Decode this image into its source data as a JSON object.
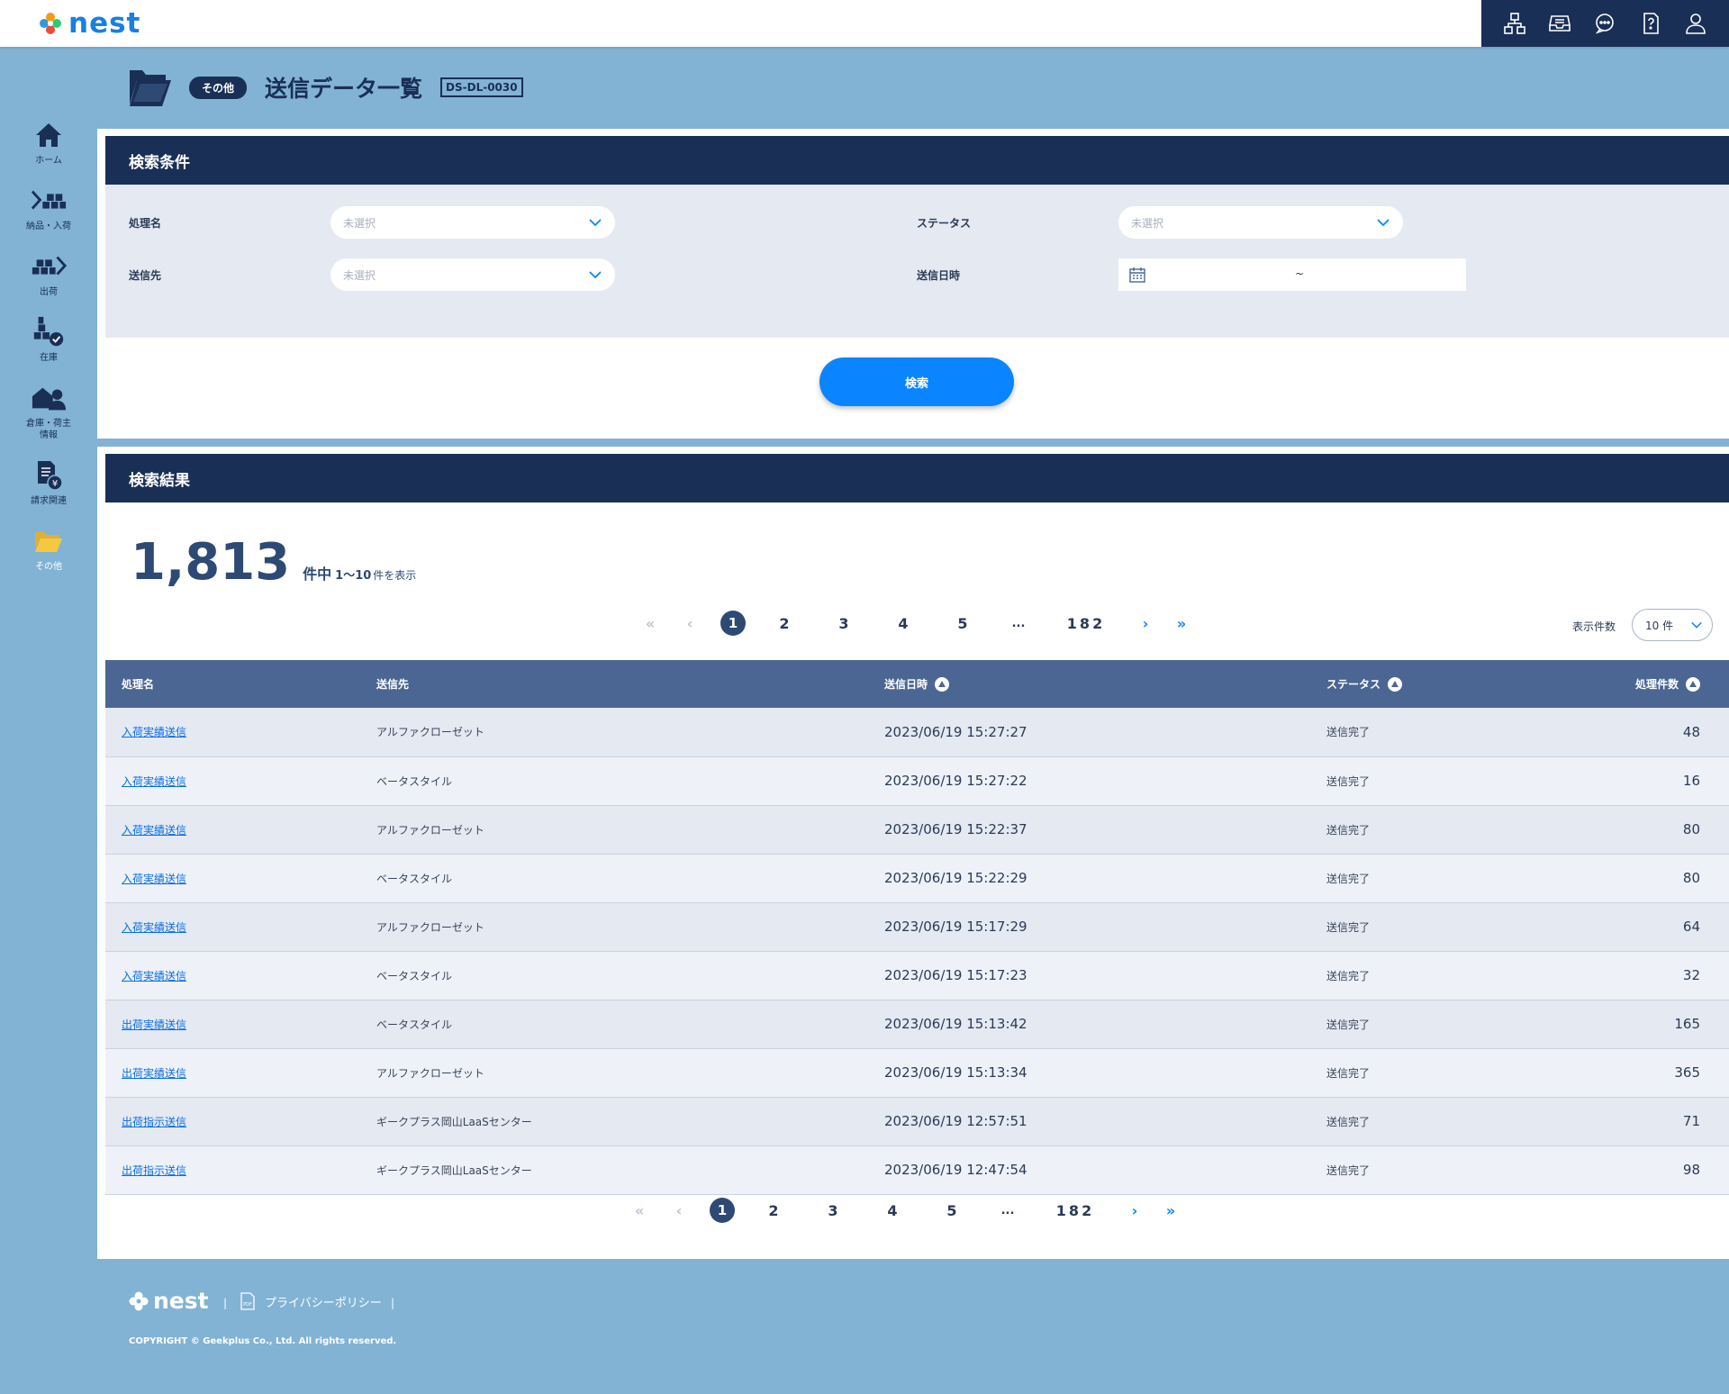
{
  "brand": {
    "name": "nest"
  },
  "topbar": {
    "icons": [
      "sitemap-icon",
      "inbox-icon",
      "chat-icon",
      "help-icon",
      "user-icon"
    ]
  },
  "sidebar": {
    "items": [
      {
        "label": "ホーム",
        "icon": "home-icon"
      },
      {
        "label": "納品・入荷",
        "icon": "inbound-icon"
      },
      {
        "label": "出荷",
        "icon": "outbound-icon"
      },
      {
        "label": "在庫",
        "icon": "stock-icon"
      },
      {
        "label": "倉庫・荷主\n情報",
        "icon": "warehouse-icon"
      },
      {
        "label": "請求関連",
        "icon": "billing-icon"
      },
      {
        "label": "その他",
        "icon": "folder-icon"
      }
    ]
  },
  "page": {
    "badge": "その他",
    "title": "送信データ一覧",
    "code": "DS-DL-0030"
  },
  "search": {
    "heading": "検索条件",
    "process_label": "処理名",
    "process_placeholder": "未選択",
    "dest_label": "送信先",
    "dest_placeholder": "未選択",
    "status_label": "ステータス",
    "status_placeholder": "未選択",
    "datetime_label": "送信日時",
    "range_sep": "~",
    "button": "検索"
  },
  "results": {
    "heading": "検索結果",
    "total": "1,813",
    "total_unit": "件中",
    "range": "1～10",
    "range_suffix": "件を表示",
    "per_page_label": "表示件数",
    "per_page_value": "10 件",
    "pages": [
      "1",
      "2",
      "3",
      "4",
      "5",
      "...",
      "182"
    ],
    "columns": {
      "process": "処理名",
      "dest": "送信先",
      "datetime": "送信日時",
      "status": "ステータス",
      "count": "処理件数"
    },
    "rows": [
      {
        "process": "入荷実績送信",
        "dest": "アルファクローゼット",
        "datetime": "2023/06/19 15:27:27",
        "status": "送信完了",
        "count": "48"
      },
      {
        "process": "入荷実績送信",
        "dest": "ベータスタイル",
        "datetime": "2023/06/19 15:27:22",
        "status": "送信完了",
        "count": "16"
      },
      {
        "process": "入荷実績送信",
        "dest": "アルファクローゼット",
        "datetime": "2023/06/19 15:22:37",
        "status": "送信完了",
        "count": "80"
      },
      {
        "process": "入荷実績送信",
        "dest": "ベータスタイル",
        "datetime": "2023/06/19 15:22:29",
        "status": "送信完了",
        "count": "80"
      },
      {
        "process": "入荷実績送信",
        "dest": "アルファクローゼット",
        "datetime": "2023/06/19 15:17:29",
        "status": "送信完了",
        "count": "64"
      },
      {
        "process": "入荷実績送信",
        "dest": "ベータスタイル",
        "datetime": "2023/06/19 15:17:23",
        "status": "送信完了",
        "count": "32"
      },
      {
        "process": "出荷実績送信",
        "dest": "ベータスタイル",
        "datetime": "2023/06/19 15:13:42",
        "status": "送信完了",
        "count": "165"
      },
      {
        "process": "出荷実績送信",
        "dest": "アルファクローゼット",
        "datetime": "2023/06/19 15:13:34",
        "status": "送信完了",
        "count": "365"
      },
      {
        "process": "出荷指示送信",
        "dest": "ギークプラス岡山LaaSセンター",
        "datetime": "2023/06/19 12:57:51",
        "status": "送信完了",
        "count": "71"
      },
      {
        "process": "出荷指示送信",
        "dest": "ギークプラス岡山LaaSセンター",
        "datetime": "2023/06/19 12:47:54",
        "status": "送信完了",
        "count": "98"
      }
    ]
  },
  "footer": {
    "brand": "nest",
    "privacy": "プライバシーポリシー",
    "copyright": "COPYRIGHT © Geekplus Co., Ltd. All rights reserved."
  },
  "colors": {
    "navy": "#1a2f55",
    "accent": "#0a84ff",
    "background": "#82b3d4",
    "active_folder": "#f5c842"
  }
}
